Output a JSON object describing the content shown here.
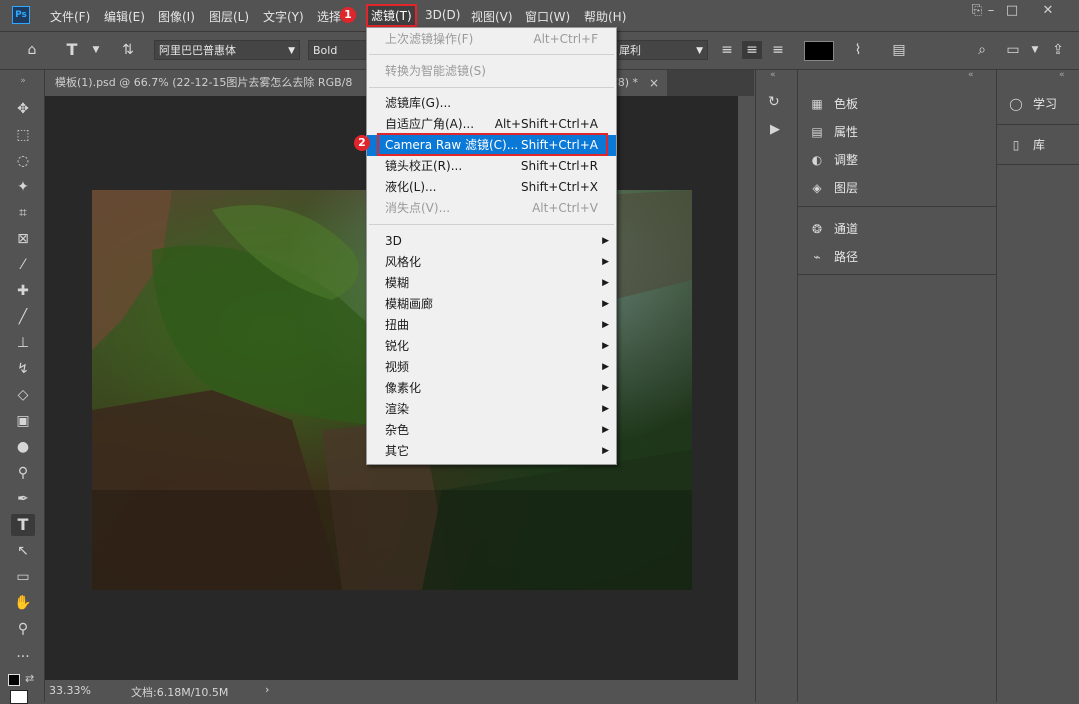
{
  "app": {
    "logo": "Ps",
    "colors": {
      "accent": "#0a78d7",
      "annotation": "#e0252b",
      "bg": "#535353",
      "canvas": "#282828"
    }
  },
  "menubar": {
    "items": [
      "文件(F)",
      "编辑(E)",
      "图像(I)",
      "图层(L)",
      "文字(Y)",
      "选择",
      "滤镜(T)",
      "3D(D)",
      "视图(V)",
      "窗口(W)",
      "帮助(H)"
    ],
    "window_controls": [
      "restore",
      "minimize",
      "maximize",
      "close"
    ]
  },
  "options": {
    "font_family": "阿里巴巴普惠体",
    "font_style": "Bold",
    "antialias": "犀利",
    "text_color": "#000000"
  },
  "document": {
    "tab_title": "模板(1).psd @ 66.7% (22-12-15图片去雾怎么去除 RGB/8",
    "tab_title_tail": "/8) *",
    "close_glyph": "×"
  },
  "status": {
    "zoom": "33.33%",
    "doc_size": "文档:6.18M/10.5M",
    "arrow": "›"
  },
  "panels": {
    "group1": [
      "色板",
      "属性",
      "调整",
      "图层"
    ],
    "group2": [
      "通道",
      "路径"
    ],
    "side": [
      "学习",
      "库"
    ]
  },
  "filter_menu": {
    "items": [
      {
        "label": "上次滤镜操作(F)",
        "shortcut": "Alt+Ctrl+F",
        "disabled": true
      },
      {
        "label": "转换为智能滤镜(S)",
        "shortcut": "",
        "disabled": true
      },
      {
        "label": "滤镜库(G)...",
        "shortcut": ""
      },
      {
        "label": "自适应广角(A)...",
        "shortcut": "Alt+Shift+Ctrl+A"
      },
      {
        "label": "Camera Raw 滤镜(C)...",
        "shortcut": "Shift+Ctrl+A",
        "highlighted": true
      },
      {
        "label": "镜头校正(R)...",
        "shortcut": "Shift+Ctrl+R"
      },
      {
        "label": "液化(L)...",
        "shortcut": "Shift+Ctrl+X"
      },
      {
        "label": "消失点(V)...",
        "shortcut": "Alt+Ctrl+V",
        "disabled": true
      },
      {
        "label": "3D",
        "submenu": true
      },
      {
        "label": "风格化",
        "submenu": true
      },
      {
        "label": "模糊",
        "submenu": true
      },
      {
        "label": "模糊画廊",
        "submenu": true
      },
      {
        "label": "扭曲",
        "submenu": true
      },
      {
        "label": "锐化",
        "submenu": true
      },
      {
        "label": "视频",
        "submenu": true
      },
      {
        "label": "像素化",
        "submenu": true
      },
      {
        "label": "渲染",
        "submenu": true
      },
      {
        "label": "杂色",
        "submenu": true
      },
      {
        "label": "其它",
        "submenu": true
      }
    ]
  },
  "annotations": {
    "step1": "1",
    "step2": "2"
  }
}
